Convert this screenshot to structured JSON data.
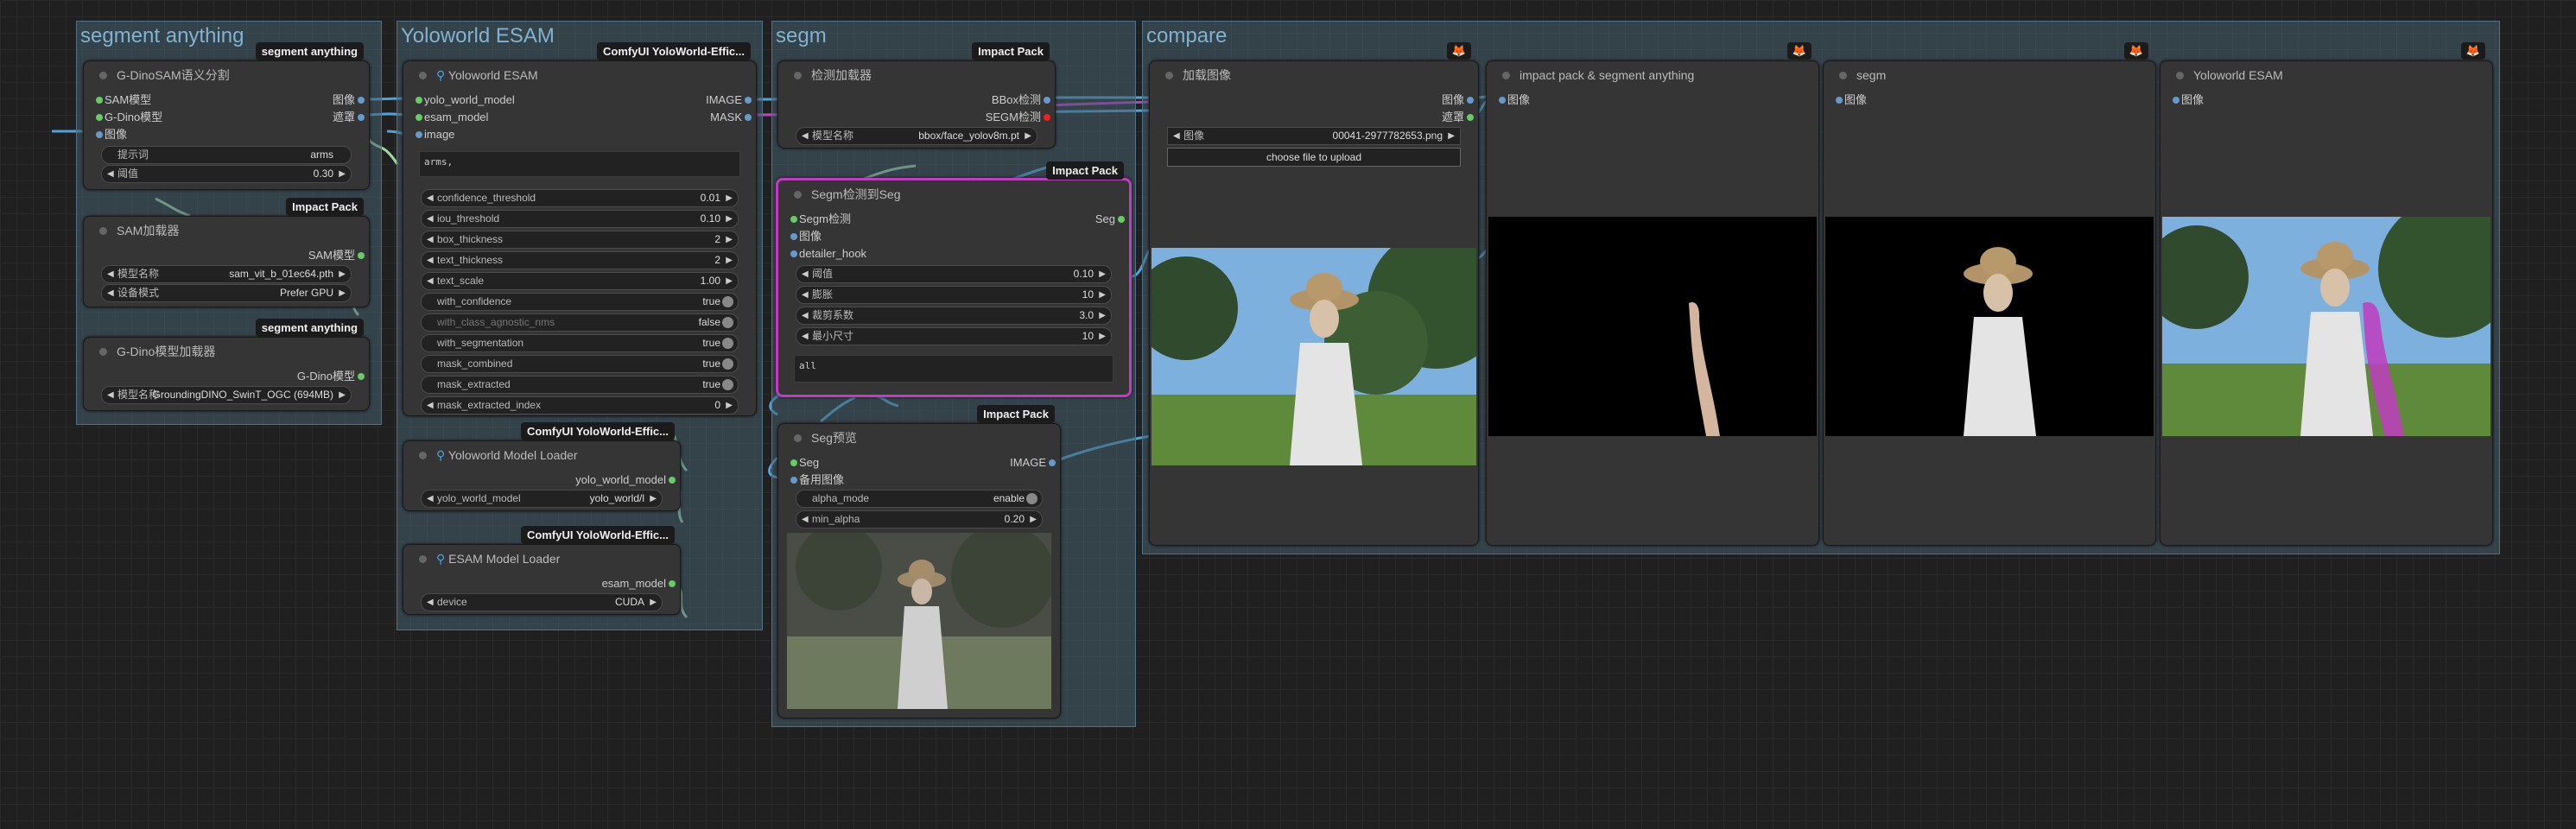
{
  "groups": {
    "segment_anything": "segment anything",
    "yoloworld_esam": "Yoloworld ESAM",
    "segm": "segm",
    "compare": "compare"
  },
  "nodes": {
    "gdino_sam": {
      "badge": "segment anything",
      "title": "G-DinoSAM语义分割",
      "in_sam": "SAM模型",
      "in_gdino": "G-Dino模型",
      "in_img": "图像",
      "out_img": "图像",
      "out_mask": "遮罩",
      "prompt_label": "提示词",
      "prompt_value": "arms",
      "thresh_label": "阈值",
      "thresh_value": "0.30"
    },
    "sam_loader": {
      "badge": "Impact Pack",
      "title": "SAM加载器",
      "out": "SAM模型",
      "model_label": "模型名称",
      "model_value": "sam_vit_b_01ec64.pth",
      "device_label": "设备模式",
      "device_value": "Prefer GPU"
    },
    "gdino_loader": {
      "badge": "segment anything",
      "title": "G-Dino模型加载器",
      "out": "G-Dino模型",
      "model_label": "模型名称",
      "model_value": "GroundingDINO_SwinT_OGC (694MB)"
    },
    "yolo_esam": {
      "badge": "ComfyUI YoloWorld-Effic...",
      "title": "Yoloworld ESAM",
      "in1": "yolo_world_model",
      "in2": "esam_model",
      "in3": "image",
      "out1": "IMAGE",
      "out2": "MASK",
      "text": "arms,",
      "widgets": [
        {
          "label": "confidence_threshold",
          "value": "0.01"
        },
        {
          "label": "iou_threshold",
          "value": "0.10"
        },
        {
          "label": "box_thickness",
          "value": "2"
        },
        {
          "label": "text_thickness",
          "value": "2"
        },
        {
          "label": "text_scale",
          "value": "1.00"
        }
      ],
      "toggles": [
        {
          "label": "with_confidence",
          "value": "true"
        },
        {
          "label": "with_class_agnostic_nms",
          "value": "false"
        },
        {
          "label": "with_segmentation",
          "value": "true"
        },
        {
          "label": "mask_combined",
          "value": "true"
        },
        {
          "label": "mask_extracted",
          "value": "true"
        }
      ],
      "index_label": "mask_extracted_index",
      "index_value": "0"
    },
    "yolo_loader": {
      "badge": "ComfyUI YoloWorld-Effic...",
      "title": "Yoloworld Model Loader",
      "out": "yolo_world_model",
      "w_label": "yolo_world_model",
      "w_value": "yolo_world/l"
    },
    "esam_loader": {
      "badge": "ComfyUI YoloWorld-Effic...",
      "title": "ESAM Model Loader",
      "out": "esam_model",
      "w_label": "device",
      "w_value": "CUDA"
    },
    "detector_loader": {
      "badge": "Impact Pack",
      "title": "检测加载器",
      "out1": "BBox检测",
      "out2": "SEGM检测",
      "model_label": "模型名称",
      "model_value": "bbox/face_yolov8m.pt"
    },
    "segm_to_seg": {
      "badge": "Impact Pack",
      "title": "Segm检测到Seg",
      "in1": "Segm检测",
      "in2": "图像",
      "in3": "detailer_hook",
      "out": "Seg",
      "widgets": [
        {
          "label": "阈值",
          "value": "0.10"
        },
        {
          "label": "膨胀",
          "value": "10"
        },
        {
          "label": "裁剪系数",
          "value": "3.0"
        },
        {
          "label": "最小尺寸",
          "value": "10"
        }
      ],
      "text": "all"
    },
    "seg_preview": {
      "badge": "Impact Pack",
      "title": "Seg预览",
      "in1": "Seg",
      "in2": "备用图像",
      "out": "IMAGE",
      "alpha_label": "alpha_mode",
      "alpha_value": "enable",
      "min_label": "min_alpha",
      "min_value": "0.20"
    },
    "load_image": {
      "title": "加载图像",
      "out1": "图像",
      "out2": "遮罩",
      "img_label": "图像",
      "img_value": "00041-2977782653.png",
      "upload": "choose file to upload"
    },
    "prev_impact": {
      "title": "impact pack & segment anything",
      "in": "图像"
    },
    "prev_segm": {
      "title": "segm",
      "in": "图像"
    },
    "prev_yolo": {
      "title": "Yoloworld ESAM",
      "in": "图像"
    }
  },
  "icons": {
    "fox": "🦊",
    "pin": "pin-icon"
  },
  "colors": {
    "accent_purple": "#c03cc0",
    "wire_blue": "#4ea3d8",
    "wire_green": "#9fd6a3"
  }
}
